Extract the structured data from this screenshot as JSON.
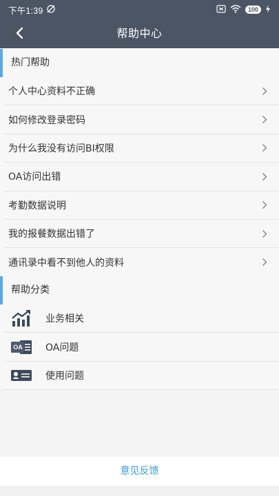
{
  "status_bar": {
    "time": "下午1:39",
    "icons": [
      "sync-off-icon",
      "sim-icon",
      "wifi-icon",
      "battery-icon",
      "charging-icon"
    ],
    "battery": "100"
  },
  "nav": {
    "title": "帮助中心",
    "back_icon": "chevron-left-icon"
  },
  "hot_help": {
    "header": "热门帮助",
    "items": [
      {
        "label": "个人中心资料不正确"
      },
      {
        "label": "如何修改登录密码"
      },
      {
        "label": "为什么我没有访问BI权限"
      },
      {
        "label": "OA访问出错"
      },
      {
        "label": "考勤数据说明"
      },
      {
        "label": "我的报餐数据出错了"
      },
      {
        "label": "通讯录中看不到他人的资料"
      }
    ]
  },
  "categories": {
    "header": "帮助分类",
    "items": [
      {
        "label": "业务相关",
        "icon": "trend-chart-icon"
      },
      {
        "label": "OA问题",
        "icon": "oa-icon",
        "icon_text": "OA"
      },
      {
        "label": "使用问题",
        "icon": "id-card-icon"
      }
    ]
  },
  "feedback": {
    "label": "意见反馈"
  },
  "colors": {
    "nav_bg": "#4b5563",
    "accent": "#5aa8e8",
    "link": "#3a9ee3"
  }
}
